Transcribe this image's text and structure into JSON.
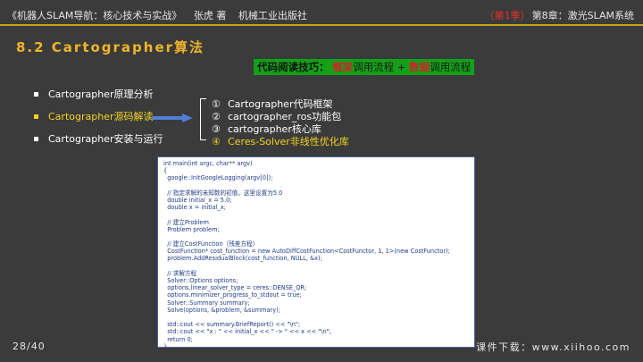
{
  "header": {
    "book_title": "《机器人SLAM导航：核心技术与实战》",
    "author": "张虎 著",
    "publisher": "机械工业出版社",
    "season": "（第1季）",
    "chapter": "第8章：激光SLAM系统"
  },
  "section_title": "8.2 Cartographer算法",
  "tip": {
    "prefix": "代码阅读技巧：",
    "part1_red": "框架",
    "part1_rest": "调用流程 + ",
    "part2_red": "数据",
    "part2_rest": "调用流程"
  },
  "bullets": [
    {
      "label": "Cartographer原理分析"
    },
    {
      "label": "Cartographer源码解读"
    },
    {
      "label": "Cartographer安装与运行"
    }
  ],
  "subitems": [
    {
      "num": "①",
      "label": "Cartographer代码框架"
    },
    {
      "num": "②",
      "label": "cartographer_ros功能包"
    },
    {
      "num": "③",
      "label": "cartographer核心库"
    },
    {
      "num": "④",
      "label": "Ceres-Solver非线性优化库"
    }
  ],
  "code_lines": [
    "int main(int argc, char** argv)",
    "{",
    "  google::InitGoogleLogging(argv[0]);",
    "",
    "  // 指定求解的未知数的初值，这里设置为5.0",
    "  double initial_x = 5.0;",
    "  double x = initial_x;",
    "",
    "  // 建立Problem",
    "  Problem problem;",
    "",
    "  // 建立CostFunction（残差方程）",
    "  CostFunction* cost_function = new AutoDiffCostFunction<CostFunctor, 1, 1>(new CostFunctor);",
    "  problem.AddResidualBlock(cost_function, NULL, &x);",
    "",
    "  // 求解方程",
    "  Solver::Options options;",
    "  options.linear_solver_type = ceres::DENSE_QR;",
    "  options.minimizer_progress_to_stdout = true;",
    "  Solver::Summary summary;",
    "  Solve(options, &problem, &summary);",
    "",
    "  std::cout << summary.BriefReport() << \"\\n\";",
    "  std::cout << \"x : \" << initial_x << \" -> \" << x << \"\\n\";",
    "  return 0;",
    "}"
  ],
  "footer": {
    "page": "28/40",
    "download": "课件下载：www.xiihoo.com"
  },
  "colors": {
    "background": "#3b3b3b",
    "accent": "#f0b429",
    "highlight": "#f2d21f",
    "tip_bg": "#12a017",
    "red": "#d4222a"
  }
}
